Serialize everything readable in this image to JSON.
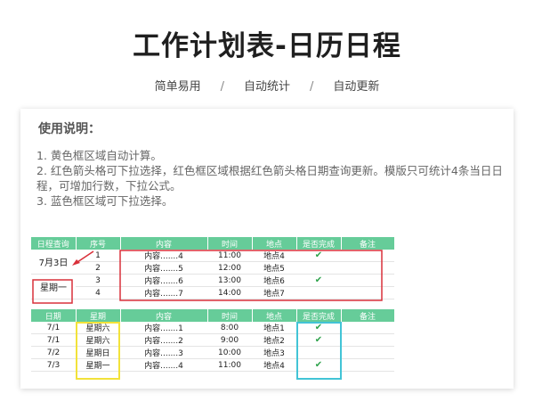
{
  "page": {
    "title": "工作计划表-日历日程",
    "tags": [
      "简单易用",
      "自动统计",
      "自动更新"
    ],
    "separator": "/"
  },
  "instructions": {
    "heading": "使用说明：",
    "lines": [
      "1. 黄色框区域自动计算。",
      "2. 红色箭头格可下拉选择，红色框区域根据红色箭头格日期查询更新。模版只可统计4条当日日程，可增加行数，下拉公式。",
      "3. 蓝色框区域可下拉选择。"
    ]
  },
  "query_table": {
    "headers": [
      "日程查询",
      "序号",
      "内容",
      "时间",
      "地点",
      "是否完成",
      "备注"
    ],
    "date": "7月3日",
    "weekday": "星期一",
    "rows": [
      {
        "no": "1",
        "content": "内容.......4",
        "time": "11:00",
        "place": "地点4",
        "done": "✔",
        "note": ""
      },
      {
        "no": "2",
        "content": "内容.......5",
        "time": "12:00",
        "place": "地点5",
        "done": "",
        "note": ""
      },
      {
        "no": "3",
        "content": "内容.......6",
        "time": "13:00",
        "place": "地点6",
        "done": "✔",
        "note": ""
      },
      {
        "no": "4",
        "content": "内容.......7",
        "time": "14:00",
        "place": "地点7",
        "done": "",
        "note": ""
      }
    ]
  },
  "schedule_table": {
    "headers": [
      "日期",
      "星期",
      "内容",
      "时间",
      "地点",
      "是否完成",
      "备注"
    ],
    "rows": [
      {
        "date": "7/1",
        "weekday": "星期六",
        "content": "内容.......1",
        "time": "8:00",
        "place": "地点1",
        "done": "✔",
        "note": ""
      },
      {
        "date": "7/1",
        "weekday": "星期六",
        "content": "内容.......2",
        "time": "9:00",
        "place": "地点2",
        "done": "✔",
        "note": ""
      },
      {
        "date": "7/2",
        "weekday": "星期日",
        "content": "内容.......3",
        "time": "10:00",
        "place": "地点3",
        "done": "",
        "note": ""
      },
      {
        "date": "7/3",
        "weekday": "星期一",
        "content": "内容.......4",
        "time": "11:00",
        "place": "地点4",
        "done": "✔",
        "note": ""
      }
    ]
  },
  "colors": {
    "header_green": "#66cc99",
    "red_box": "#d9303a",
    "yellow_box": "#f2e23a",
    "blue_box": "#42c4d6",
    "check_green": "#2fa34c"
  }
}
